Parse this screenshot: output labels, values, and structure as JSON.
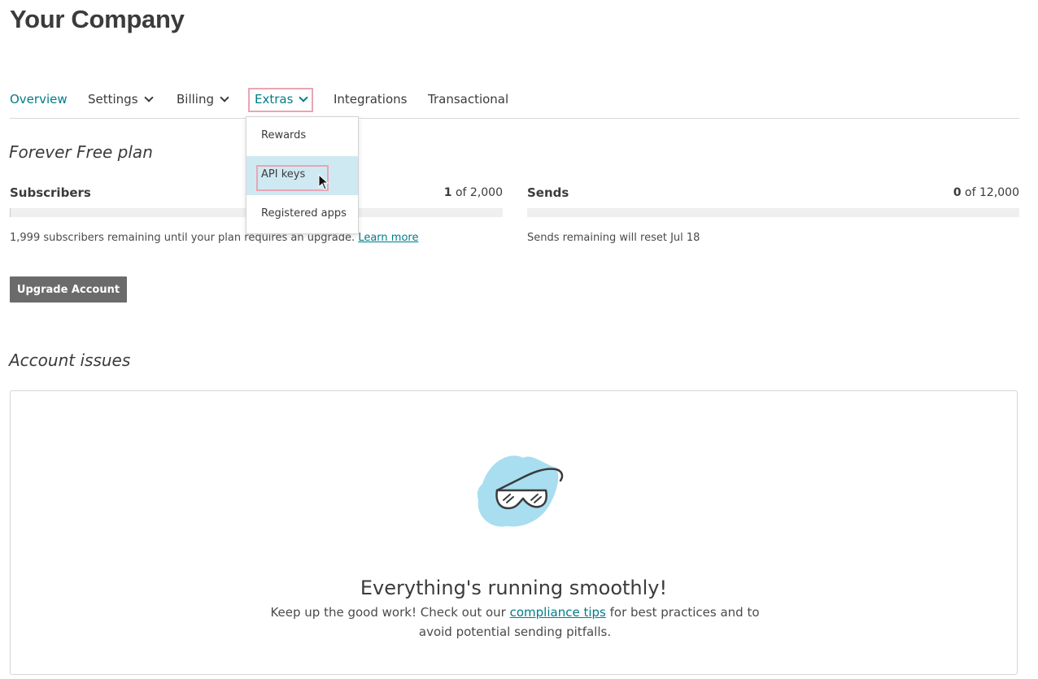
{
  "page": {
    "title": "Your Company"
  },
  "nav": {
    "items": [
      {
        "label": "Overview",
        "active": true,
        "has_dropdown": false
      },
      {
        "label": "Settings",
        "has_dropdown": true
      },
      {
        "label": "Billing",
        "has_dropdown": true
      },
      {
        "label": "Extras",
        "has_dropdown": true,
        "open": true
      },
      {
        "label": "Integrations",
        "has_dropdown": false
      },
      {
        "label": "Transactional",
        "has_dropdown": false
      }
    ]
  },
  "extras_menu": {
    "items": [
      {
        "label": "Rewards"
      },
      {
        "label": "API keys",
        "selected": true
      },
      {
        "label": "Registered apps"
      }
    ]
  },
  "plan": {
    "title": "Forever Free plan",
    "subscribers": {
      "label": "Subscribers",
      "used": "1",
      "of_text": "of",
      "limit": "2,000",
      "fraction": 0.0005,
      "note": "1,999 subscribers remaining until your plan requires an upgrade.",
      "link": "Learn more"
    },
    "sends": {
      "label": "Sends",
      "used": "0",
      "of_text": "of",
      "limit": "12,000",
      "fraction": 0,
      "note": "Sends remaining will reset Jul 18"
    },
    "upgrade_button": "Upgrade Account"
  },
  "issues": {
    "title": "Account issues",
    "headline": "Everything's running smoothly!",
    "text_before": "Keep up the good work! Check out our",
    "link": "compliance tips",
    "text_after": "for best practices and to avoid potential sending pitfalls.",
    "illustration_icon": "safety-goggles-icon"
  },
  "colors": {
    "accent": "#007c89",
    "highlight_outline": "#e9a5b3",
    "selected_bg": "#cfe9f2",
    "button": "#6b6b6b"
  }
}
